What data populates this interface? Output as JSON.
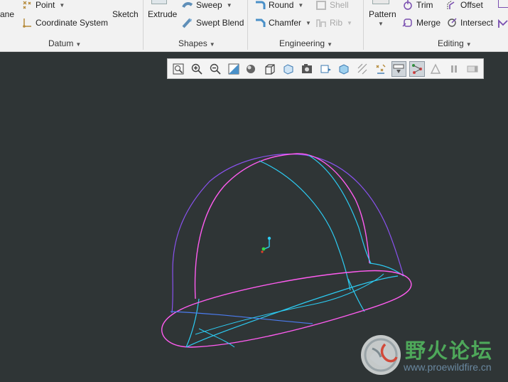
{
  "ribbon": {
    "datum": {
      "plane_partial": "ane",
      "point": "Point",
      "coordinate_system": "Coordinate System",
      "sketch": "Sketch",
      "label": "Datum"
    },
    "shapes": {
      "extrude": "Extrude",
      "sweep": "Sweep",
      "swept_blend": "Swept Blend",
      "label": "Shapes"
    },
    "engineering": {
      "round": "Round",
      "chamfer": "Chamfer",
      "shell": "Shell",
      "rib": "Rib",
      "label": "Engineering"
    },
    "editing": {
      "pattern": "Pattern",
      "trim": "Trim",
      "offset": "Offset",
      "merge": "Merge",
      "intersect": "Intersect",
      "label": "Editing"
    }
  },
  "view_toolbar": {
    "buttons": [
      "refit-icon",
      "zoom-in-icon",
      "zoom-out-icon",
      "repaint-icon",
      "display-style-icon",
      "saved-views-icon",
      "view-manager-icon",
      "perspective-icon",
      "named-views-icon",
      "section-icon",
      "datum-display-icon",
      "spin-center-icon",
      "annotation-display-icon",
      "selected-toggle-icon",
      "cosmetic-icon",
      "pause-icon",
      "last-icon"
    ]
  },
  "watermark": {
    "site_name": "野火论坛",
    "url": "www.proewildfire.cn"
  },
  "colors": {
    "viewport_bg": "#2f3536",
    "magenta_edge": "#ff5cf0",
    "cyan_edge": "#2ccbf2",
    "blue_edge": "#4b7cf0",
    "purple_edge": "#8a52f0"
  }
}
